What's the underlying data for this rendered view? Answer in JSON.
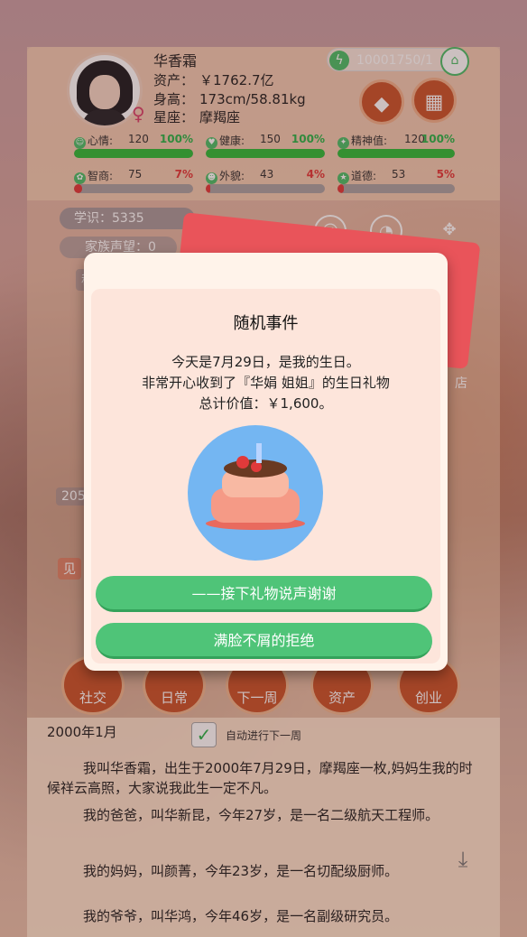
{
  "player": {
    "name": "华香霜",
    "assets_label": "资产：",
    "assets_value": "￥1762.7亿",
    "height_label": "身高：",
    "height_value": "173cm/58.81kg",
    "zodiac_label": "星座：",
    "zodiac_value": "摩羯座",
    "gender_icon": "female-icon"
  },
  "currency": {
    "icon": "lightning-icon",
    "value": "10001750/1"
  },
  "stats": [
    {
      "label": "心情:",
      "value": "120",
      "percent": "100%",
      "fill": 1.0,
      "color": "#2ebd3a"
    },
    {
      "label": "健康:",
      "value": "150",
      "percent": "100%",
      "fill": 1.0,
      "color": "#2ebd3a"
    },
    {
      "label": "精神值:",
      "value": "120",
      "percent": "100%",
      "fill": 1.0,
      "color": "#2ebd3a"
    },
    {
      "label": "智商:",
      "value": "75",
      "percent": "7%",
      "fill": 0.07,
      "color": "#e23a3a"
    },
    {
      "label": "外貌:",
      "value": "43",
      "percent": "4%",
      "fill": 0.04,
      "color": "#e23a3a"
    },
    {
      "label": "道德:",
      "value": "53",
      "percent": "5%",
      "fill": 0.05,
      "color": "#e23a3a"
    }
  ],
  "left_panel": {
    "knowledge": "学识：5335",
    "family_reputation": "家族声望：0",
    "peek_1": "称",
    "peek_2": "205",
    "peek_3": "见"
  },
  "side_labels": {
    "shop_peek": "店"
  },
  "modal": {
    "title": "随机事件",
    "line1": "今天是7月29日，是我的生日。",
    "line2": "非常开心收到了『华娟 姐姐』的生日礼物",
    "line3": "总计价值：￥1,600。",
    "image": "birthday-cake",
    "choice1": "——接下礼物说声谢谢",
    "choice2": "满脸不屑的拒绝"
  },
  "nav": [
    {
      "label": "社交"
    },
    {
      "label": "日常"
    },
    {
      "label": "下一周"
    },
    {
      "label": "资产"
    },
    {
      "label": "创业"
    }
  ],
  "log": {
    "date": "2000年1月",
    "auto_label": "自动进行下一周",
    "auto_checked": true,
    "paragraphs": [
      "我叫华香霜，出生于2000年7月29日，摩羯座一枚,妈妈生我的时候祥云高照，大家说我此生一定不凡。",
      "我的爸爸，叫华新昆，今年27岁，是一名二级航天工程师。",
      "我的妈妈，叫颜菁，今年23岁，是一名切配级厨师。",
      "我的爷爷，叫华鸿，今年46岁，是一名副级研究员。"
    ]
  },
  "colors": {
    "accent": "#c9552c",
    "choice_green": "#4fc478",
    "good": "#2ebd3a",
    "bad": "#e23a3a"
  }
}
